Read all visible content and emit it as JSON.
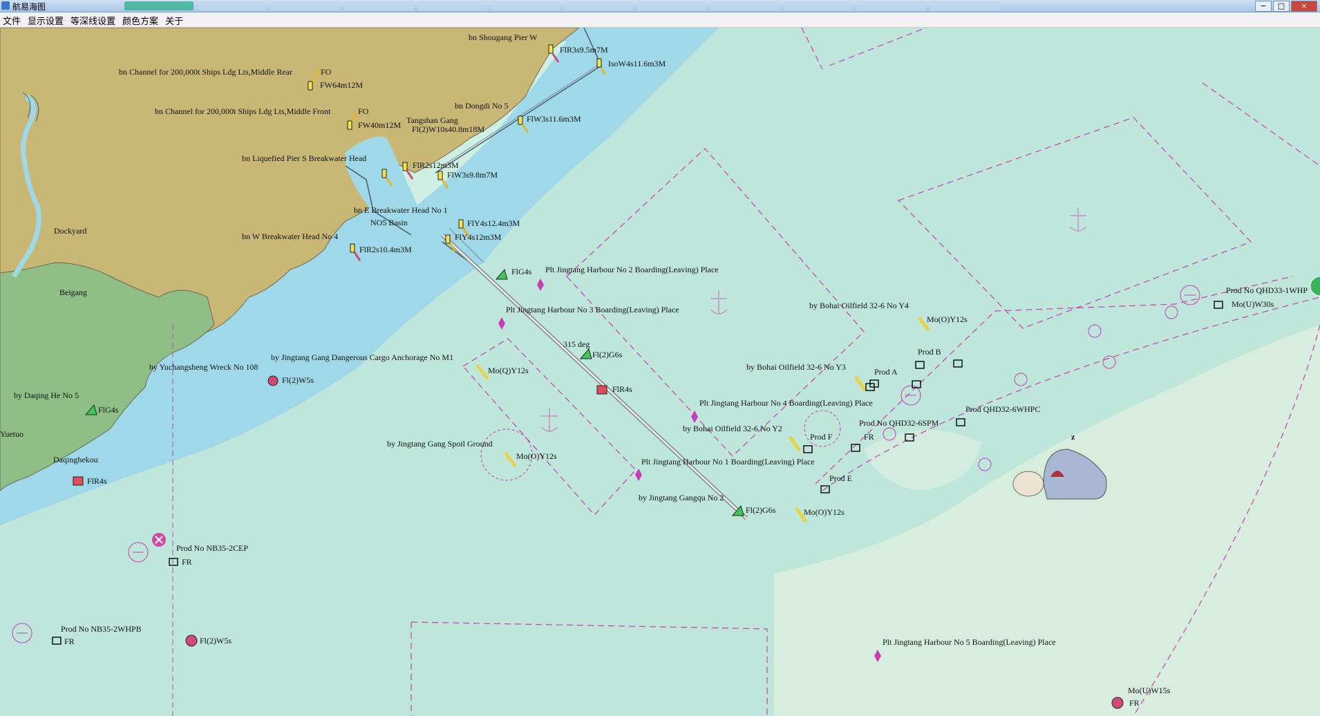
{
  "window": {
    "title": "航易海图"
  },
  "menu": [
    "文件",
    "显示设置",
    "等深线设置",
    "颜色方案",
    "关于"
  ],
  "colors": {
    "land": "#c9b776",
    "marsh": "#8fbe86",
    "shallow": "#9fd8e8",
    "sea": "#bfe6da",
    "deep": "#d8eedd",
    "magenta": "#c83cb8"
  },
  "labels": {
    "bn_shougang_pier_w": "bn Shougang Pier W",
    "flr3s": "FlR3s9.5m7M",
    "iso_w4s": "IsoW4s11.6m3M",
    "bn_channel_rear": "bn Channel for 200,000t Ships Ldg Lts,Middle Rear",
    "fo_rear": "FO",
    "fw64": "FW64m12M",
    "bn_channel_front": "bn Channel for 200,000t Ships Ldg Lts,Middle Front",
    "fo_front": "FO",
    "fw40": "FW40m12M",
    "tangshan_gang": "Tangshan Gang",
    "fl2_w10s": "Fl(2)W10s40.8m18M",
    "bn_dongdi": "bn Dongdi No 5",
    "flw3s11": "FlW3s11.6m3M",
    "bn_lng": "bn Liquefied Pier S Breakwater Head",
    "flr2s12": "FlR2s12m3M",
    "flw3s9": "FlW3s9.8m7M",
    "bn_e_breakwater": "bn E Breakwater Head No 1",
    "no5_basin": "NO5 Basin",
    "fly4s12_4": "FlY4s12.4m3M",
    "bn_w_breakwater": "bn W Breakwater Head No 4",
    "fly4s12": "FlY4s12m3M",
    "flr2s10": "FlR2s10.4m3M",
    "dockyard": "Dockyard",
    "beigang": "Beigang",
    "flg4s_a": "FlG4s",
    "plt_no2": "Plt Jingtang Harbour No 2 Boarding(Leaving) Place",
    "plt_no3": "Plt Jingtang Harbour No 3 Boarding(Leaving) Place",
    "by_yuchangsheng": "by Yuchangsheng Wreck No 108",
    "by_dangerous": "by Jingtang Gang Dangerous Cargo  Anchorage No M1",
    "moq_y12s": "Mo(Q)Y12s",
    "deg315": "315 deg",
    "fl2_g6s_a": "Fl(2)G6s",
    "flr4s_a": "FlR4s",
    "fl2_w5s_a": "Fl(2)W5s",
    "by_daqing": "by Daqing He No 5",
    "flg4s_b": "FlG4s",
    "yuetuo": "Yuetuo",
    "daqinghekou": "Daqinghekou",
    "flr4s_b": "FlR4s",
    "by_spoil": "by Jingtang Gang Spoil Ground",
    "moo_y12s_a": "Mo(O)Y12s",
    "by_bohai_y4": "by Bohai Oilfield 32-6 No Y4",
    "moo_y12s_b": "Mo(O)Y12s",
    "prod_b": "Prod B",
    "by_bohai_y3": "by Bohai Oilfield 32-6 No Y3",
    "prod_a": "Prod A",
    "plt_no4": "Plt Jingtang Harbour No 4 Boarding(Leaving) Place",
    "by_bohai_y2": "by Bohai Oilfield 32-6 No Y2",
    "prod_f": "Prod F",
    "prod_qhd32_6spm": "Prod No QHD32-6SPM",
    "fr_a": "FR",
    "prod_qhd32_6whpc": "Prod QHD32-6WHPC",
    "prod_qhd33": "Prod No QHD33-1WHP",
    "mou_w30s": "Mo(U)W30s",
    "plt_no1": "Plt Jingtang Harbour No 1 Boarding(Leaving) Place",
    "prod_e": "Prod E",
    "by_gangqu": "by Jingtang Gangqu No 2",
    "fl2_g6s_b": "Fl(2)G6s",
    "moo_y12s_c": "Mo(O)Y12s",
    "prod_nb35_2cep": "Prod No NB35-2CEP",
    "fr_b": "FR",
    "prod_nb35_2whpb": "Prod No NB35-2WHPB",
    "fr_c": "FR",
    "fl2_w5s_b": "Fl(2)W5s",
    "plt_no5": "Plt Jingtang Harbour No 5 Boarding(Leaving) Place",
    "mou_w15s": "Mo(U)W15s",
    "fr_d": "FR"
  }
}
